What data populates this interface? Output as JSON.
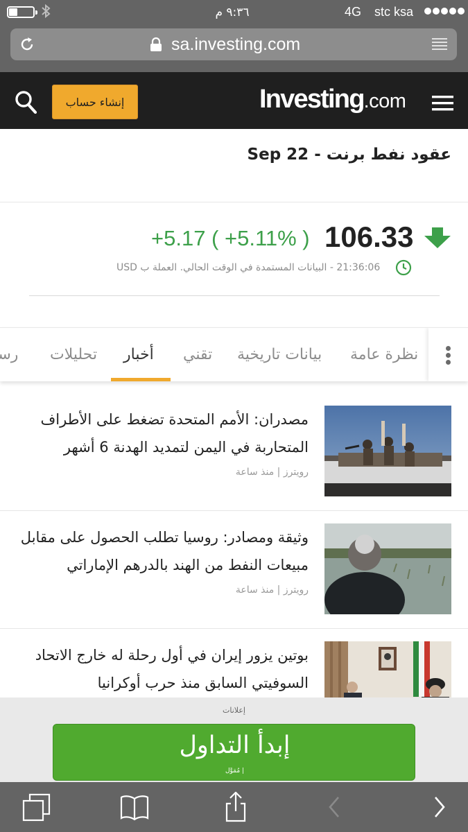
{
  "status_bar": {
    "time": "٩:٣٦ م",
    "network": "4G",
    "carrier": "stc ksa"
  },
  "browser": {
    "url": "sa.investing.com"
  },
  "header": {
    "logo_main": "Investing",
    "logo_suffix": ".com",
    "signup_label": "إنشاء حساب"
  },
  "instrument": {
    "title": "عقود نفط برنت - Sep 22"
  },
  "quote": {
    "price": "106.33",
    "change": "+5.17 ( +5.11% )",
    "realtime_note": "21:36:06 - البيانات المستمدة في الوقت الحالي. العملة ب USD",
    "direction": "down",
    "arrow_color": "#3da04a",
    "change_color": "#3da04a"
  },
  "tabs": [
    {
      "label": "نظرة عامة",
      "active": false
    },
    {
      "label": "بيانات تاريخية",
      "active": false
    },
    {
      "label": "تقني",
      "active": false
    },
    {
      "label": "أخبار",
      "active": true
    },
    {
      "label": "تحليلات",
      "active": false
    },
    {
      "label": "رسو",
      "active": false
    }
  ],
  "news": [
    {
      "headline": "مصدران: الأمم المتحدة تضغط على الأطراف المتحاربة في اليمن لتمديد الهدنة 6 أشهر",
      "source": "رويترز",
      "time": "منذ ساعة"
    },
    {
      "headline": "وثيقة ومصادر: روسيا تطلب الحصول على مقابل مبيعات النفط من الهند بالدرهم الإماراتي",
      "source": "رويترز",
      "time": "منذ ساعة"
    },
    {
      "headline": "بوتين يزور إيران في أول رحلة له خارج الاتحاد السوفيتي السابق منذ حرب أوكرانيا",
      "source": "",
      "time": ""
    }
  ],
  "ad": {
    "label": "إعلانات",
    "button_label": "إبدأ التداول",
    "sponsor_note": "مُمَوَّل |",
    "button_color": "#50aa2f"
  },
  "colors": {
    "header_bg": "#1f1f1f",
    "accent": "#f0a92d",
    "positive": "#3da04a"
  }
}
